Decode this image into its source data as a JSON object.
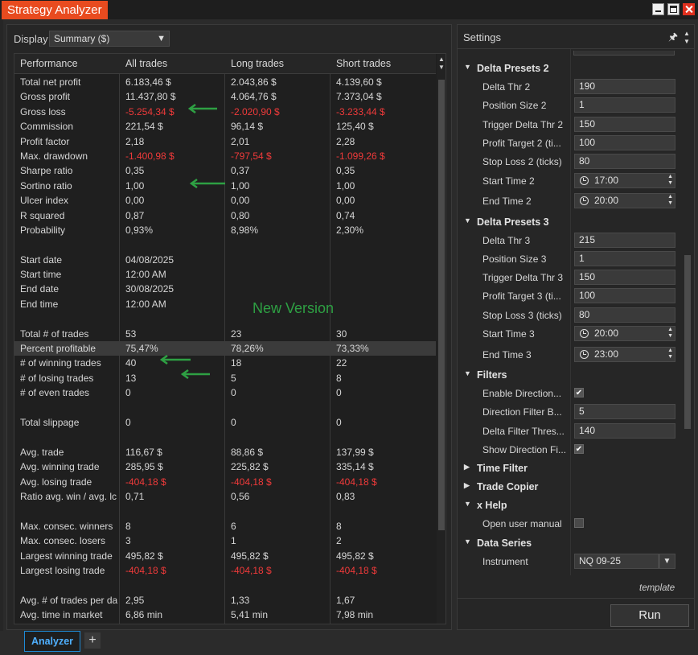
{
  "window": {
    "title": "Strategy Analyzer"
  },
  "display": {
    "label": "Display",
    "selected": "Summary ($)"
  },
  "table": {
    "headers": [
      "Performance",
      "All trades",
      "Long trades",
      "Short trades"
    ],
    "rows": [
      {
        "label": "Total net profit",
        "all": "6.183,46 $",
        "long": "2.043,86 $",
        "short": "4.139,60 $"
      },
      {
        "label": "Gross profit",
        "all": "11.437,80 $",
        "long": "4.064,76 $",
        "short": "7.373,04 $"
      },
      {
        "label": "Gross loss",
        "all": "-5.254,34 $",
        "long": "-2.020,90 $",
        "short": "-3.233,44 $",
        "neg": true
      },
      {
        "label": "Commission",
        "all": "221,54 $",
        "long": "96,14 $",
        "short": "125,40 $"
      },
      {
        "label": "Profit factor",
        "all": "2,18",
        "long": "2,01",
        "short": "2,28"
      },
      {
        "label": "Max. drawdown",
        "all": "-1.400,98 $",
        "long": "-797,54 $",
        "short": "-1.099,26 $",
        "neg": true
      },
      {
        "label": "Sharpe ratio",
        "all": "0,35",
        "long": "0,37",
        "short": "0,35"
      },
      {
        "label": "Sortino ratio",
        "all": "1,00",
        "long": "1,00",
        "short": "1,00"
      },
      {
        "label": "Ulcer index",
        "all": "0,00",
        "long": "0,00",
        "short": "0,00"
      },
      {
        "label": "R squared",
        "all": "0,87",
        "long": "0,80",
        "short": "0,74"
      },
      {
        "label": "Probability",
        "all": "0,93%",
        "long": "8,98%",
        "short": "2,30%"
      },
      {
        "label": "",
        "all": "",
        "long": "",
        "short": ""
      },
      {
        "label": "Start date",
        "all": "04/08/2025",
        "long": "",
        "short": ""
      },
      {
        "label": "Start time",
        "all": "12:00 AM",
        "long": "",
        "short": ""
      },
      {
        "label": "End date",
        "all": "30/08/2025",
        "long": "",
        "short": ""
      },
      {
        "label": "End time",
        "all": "12:00 AM",
        "long": "",
        "short": ""
      },
      {
        "label": "",
        "all": "",
        "long": "",
        "short": ""
      },
      {
        "label": "Total # of trades",
        "all": "53",
        "long": "23",
        "short": "30"
      },
      {
        "label": "Percent profitable",
        "all": "75,47%",
        "long": "78,26%",
        "short": "73,33%",
        "highlight": true
      },
      {
        "label": "# of winning trades",
        "all": "40",
        "long": "18",
        "short": "22"
      },
      {
        "label": "# of losing trades",
        "all": "13",
        "long": "5",
        "short": "8"
      },
      {
        "label": "# of even trades",
        "all": "0",
        "long": "0",
        "short": "0"
      },
      {
        "label": "",
        "all": "",
        "long": "",
        "short": ""
      },
      {
        "label": "Total slippage",
        "all": "0",
        "long": "0",
        "short": "0"
      },
      {
        "label": "",
        "all": "",
        "long": "",
        "short": ""
      },
      {
        "label": "Avg. trade",
        "all": "116,67 $",
        "long": "88,86 $",
        "short": "137,99 $"
      },
      {
        "label": "Avg. winning trade",
        "all": "285,95 $",
        "long": "225,82 $",
        "short": "335,14 $"
      },
      {
        "label": "Avg. losing trade",
        "all": "-404,18 $",
        "long": "-404,18 $",
        "short": "-404,18 $",
        "neg": true
      },
      {
        "label": "Ratio avg. win / avg. lc",
        "all": "0,71",
        "long": "0,56",
        "short": "0,83"
      },
      {
        "label": "",
        "all": "",
        "long": "",
        "short": ""
      },
      {
        "label": "Max. consec. winners",
        "all": "8",
        "long": "6",
        "short": "8"
      },
      {
        "label": "Max. consec. losers",
        "all": "3",
        "long": "1",
        "short": "2"
      },
      {
        "label": "Largest winning trade",
        "all": "495,82 $",
        "long": "495,82 $",
        "short": "495,82 $"
      },
      {
        "label": "Largest losing trade",
        "all": "-404,18 $",
        "long": "-404,18 $",
        "short": "-404,18 $",
        "neg": true
      },
      {
        "label": "",
        "all": "",
        "long": "",
        "short": ""
      },
      {
        "label": "Avg. # of trades per da",
        "all": "2,95",
        "long": "1,33",
        "short": "1,67"
      },
      {
        "label": "Avg. time in market",
        "all": "6,86 min",
        "long": "5,41 min",
        "short": "7,98 min"
      }
    ]
  },
  "annotation": {
    "text": "New Version",
    "color": "#2ea043"
  },
  "bottom_tabs": {
    "active": "Analyzer",
    "add": "+"
  },
  "settings": {
    "title": "Settings",
    "items": [
      {
        "kind": "cat",
        "label": "Delta Presets 2",
        "expanded": true
      },
      {
        "kind": "text",
        "label": "Delta Thr 2",
        "value": "190"
      },
      {
        "kind": "text",
        "label": "Position Size 2",
        "value": "1"
      },
      {
        "kind": "text",
        "label": "Trigger Delta Thr 2",
        "value": "150"
      },
      {
        "kind": "text",
        "label": "Profit Target 2 (ti...",
        "value": "100"
      },
      {
        "kind": "text",
        "label": "Stop Loss 2 (ticks)",
        "value": "80"
      },
      {
        "kind": "time",
        "label": "Start Time 2",
        "value": "17:00"
      },
      {
        "kind": "time",
        "label": "End Time 2",
        "value": "20:00"
      },
      {
        "kind": "cat",
        "label": "Delta Presets 3",
        "expanded": true
      },
      {
        "kind": "text",
        "label": "Delta Thr 3",
        "value": "215"
      },
      {
        "kind": "text",
        "label": "Position Size 3",
        "value": "1"
      },
      {
        "kind": "text",
        "label": "Trigger Delta Thr 3",
        "value": "150"
      },
      {
        "kind": "text",
        "label": "Profit Target 3 (ti...",
        "value": "100"
      },
      {
        "kind": "text",
        "label": "Stop Loss 3 (ticks)",
        "value": "80"
      },
      {
        "kind": "time",
        "label": "Start Time 3",
        "value": "20:00"
      },
      {
        "kind": "time",
        "label": "End Time 3",
        "value": "23:00"
      },
      {
        "kind": "cat",
        "label": "Filters",
        "expanded": true
      },
      {
        "kind": "check",
        "label": "Enable Direction...",
        "checked": true
      },
      {
        "kind": "text",
        "label": "Direction Filter B...",
        "value": "5"
      },
      {
        "kind": "text",
        "label": "Delta Filter Thres...",
        "value": "140"
      },
      {
        "kind": "check",
        "label": "Show Direction Fi...",
        "checked": true
      },
      {
        "kind": "cat",
        "label": "Time Filter",
        "expanded": false
      },
      {
        "kind": "cat",
        "label": "Trade Copier",
        "expanded": false
      },
      {
        "kind": "cat",
        "label": "x Help",
        "expanded": true
      },
      {
        "kind": "check",
        "label": "Open user manual",
        "checked": false
      },
      {
        "kind": "cat",
        "label": "Data Series",
        "expanded": true
      },
      {
        "kind": "dropdown",
        "label": "Instrument",
        "value": "NQ 09-25"
      }
    ],
    "template_label": "template",
    "run_label": "Run"
  },
  "icons": {
    "collapse": "▼",
    "expand": "▶",
    "check": "✔",
    "pin": "pin-icon",
    "clock": "clock-icon"
  }
}
